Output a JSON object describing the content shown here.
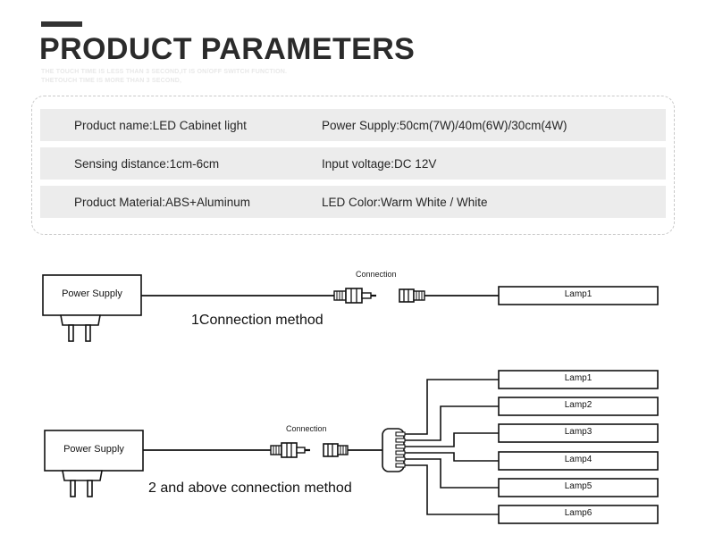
{
  "header": {
    "title": "PRODUCT PARAMETERS",
    "subtitle_lines": [
      "THE TOUCH TIME IS LESS THAN 3 SECOND,IT IS ON/OFF SWITCH FUNCTION.",
      "THETOUCH TIME IS MORE THAN 3 SECOND,"
    ],
    "accent_color": "#333333"
  },
  "spec_table": {
    "rows": [
      {
        "left": "Product name:LED Cabinet light",
        "right": "Power Supply:50cm(7W)/40m(6W)/30cm(4W)"
      },
      {
        "left": "Sensing distance:1cm-6cm",
        "right": "Input voltage:DC 12V"
      },
      {
        "left": "Product Material:ABS+Aluminum",
        "right": "LED Color:Warm White / White"
      }
    ],
    "row_bg": "#ececec",
    "border_color": "#c9c9c9"
  },
  "diagram_1": {
    "power_supply_label": "Power Supply",
    "connection_label": "Connection",
    "lamp_label": "Lamp1",
    "caption": "1Connection method"
  },
  "diagram_2": {
    "power_supply_label": "Power Supply",
    "connection_label": "Connection",
    "caption": "2 and above connection method",
    "lamps": [
      "Lamp1",
      "Lamp2",
      "Lamp3",
      "Lamp4",
      "Lamp5",
      "Lamp6"
    ]
  }
}
